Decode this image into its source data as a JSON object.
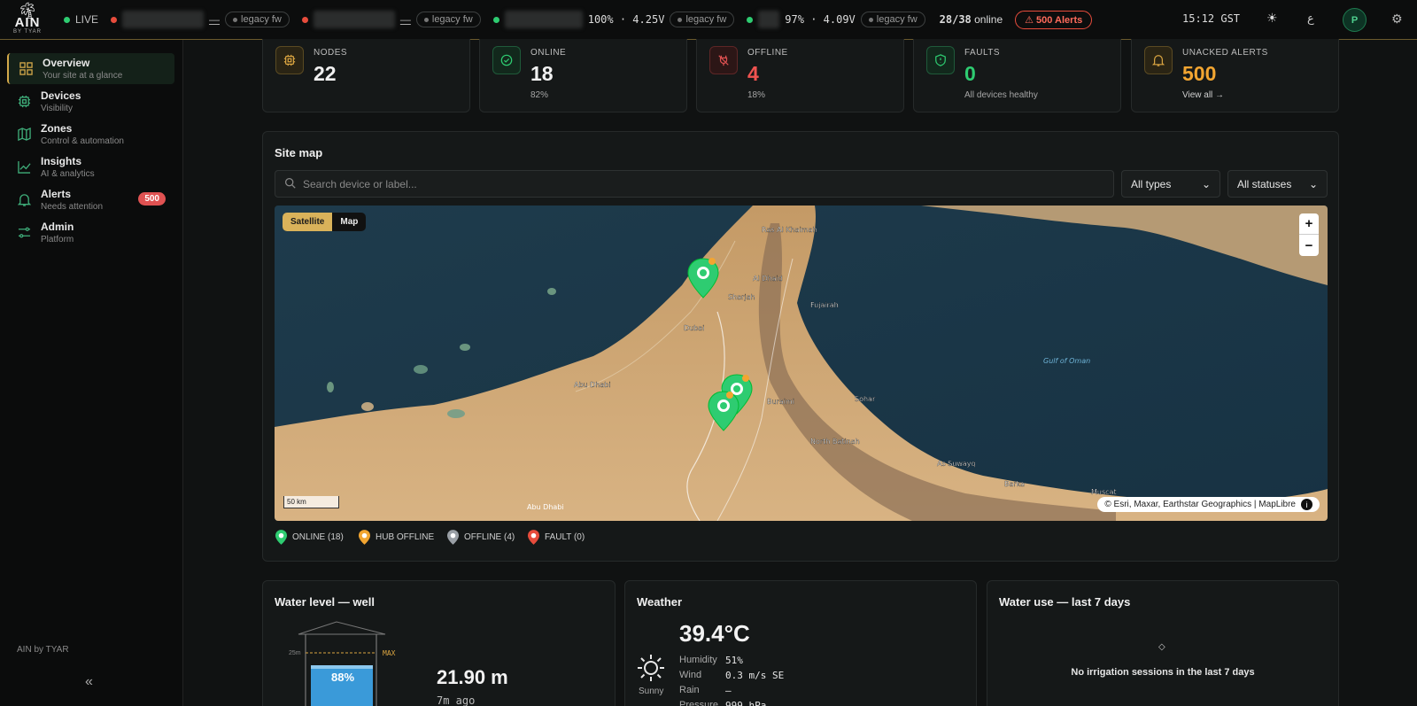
{
  "brand": {
    "logo_text": "AIN",
    "logo_sub": "BY TYAR",
    "footer": "AIN by TYAR"
  },
  "topbar": {
    "live_label": "LIVE",
    "devices": [
      {
        "status": "red",
        "value": "—",
        "fw": "legacy fw"
      },
      {
        "status": "red",
        "value": "—",
        "fw": "legacy fw"
      },
      {
        "status": "green",
        "value": "100% · 4.25V",
        "fw": "legacy fw"
      },
      {
        "status": "green",
        "value": "97% · 4.09V",
        "fw": "legacy fw"
      }
    ],
    "online_count": "28/38",
    "online_label": "online",
    "alerts_label": "⚠ 500 Alerts",
    "time": "15:12 GST",
    "lang": "ع",
    "avatar": "P"
  },
  "sidebar": {
    "items": [
      {
        "label": "Overview",
        "sub": "Your site at a glance",
        "icon": "grid-icon"
      },
      {
        "label": "Devices",
        "sub": "Visibility",
        "icon": "chip-icon"
      },
      {
        "label": "Zones",
        "sub": "Control & automation",
        "icon": "map-icon"
      },
      {
        "label": "Insights",
        "sub": "AI & analytics",
        "icon": "chart-icon"
      },
      {
        "label": "Alerts",
        "sub": "Needs attention",
        "icon": "bell-icon",
        "badge": "500"
      },
      {
        "label": "Admin",
        "sub": "Platform",
        "icon": "sliders-icon"
      }
    ],
    "collapse_glyph": "«"
  },
  "stats": [
    {
      "title": "NODES",
      "value": "22",
      "sub": "",
      "color": "#f0f0f0",
      "accent": "#d9a441"
    },
    {
      "title": "ONLINE",
      "value": "18",
      "sub": "82%",
      "color": "#f0f0f0",
      "accent": "#2ecc71"
    },
    {
      "title": "OFFLINE",
      "value": "4",
      "sub": "18%",
      "color": "#ef5350",
      "accent": "#e05252"
    },
    {
      "title": "FAULTS",
      "value": "0",
      "sub": "All devices healthy",
      "color": "#2ecc71",
      "accent": "#2ecc71"
    },
    {
      "title": "UNACKED ALERTS",
      "value": "500",
      "sub": "View all →",
      "color": "#f2a531",
      "accent": "#d9a441"
    }
  ],
  "sitemap": {
    "title": "Site map",
    "search_placeholder": "Search device or label...",
    "type_filter": "All types",
    "status_filter": "All statuses",
    "toggle": [
      "Satellite",
      "Map"
    ],
    "scale": "50 km",
    "attribution": "© Esri, Maxar, Earthstar Geographics | MapLibre",
    "places": [
      "Ras Al Khaimah",
      "Al Dhaid",
      "Sharjah",
      "Fujairah",
      "Dubai",
      "Abu Dhabi",
      "Buraimi",
      "Sohar",
      "North Batinah",
      "As Suwayq",
      "Barka",
      "Muscat",
      "Gulf of Oman"
    ],
    "legend": [
      {
        "label": "ONLINE (18)",
        "color": "#2ecc71"
      },
      {
        "label": "HUB OFFLINE",
        "color": "#f2a531"
      },
      {
        "label": "OFFLINE (4)",
        "color": "#9aa0a6"
      },
      {
        "label": "FAULT (0)",
        "color": "#e74c3c"
      }
    ]
  },
  "water_level": {
    "title": "Water level — well",
    "percent": "88%",
    "percent_value": 0.88,
    "depth_label": "25m",
    "max_label": "MAX",
    "value": "21.90 m",
    "ago": "7m ago"
  },
  "weather": {
    "title": "Weather",
    "temp": "39.4°C",
    "condition": "Sunny",
    "rows": [
      {
        "label": "Humidity",
        "value": "51%"
      },
      {
        "label": "Wind",
        "value": "0.3 m/s SE"
      },
      {
        "label": "Rain",
        "value": "—"
      },
      {
        "label": "Pressure",
        "value": "999 hPa"
      }
    ]
  },
  "water_use": {
    "title": "Water use — last 7 days",
    "empty": "No irrigation sessions in the last 7 days"
  }
}
